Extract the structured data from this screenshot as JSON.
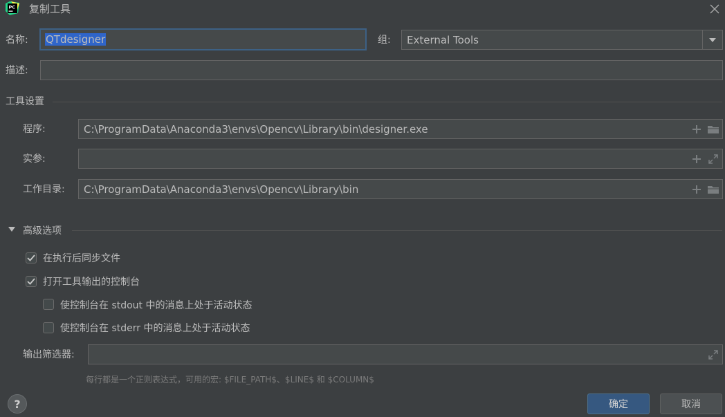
{
  "window": {
    "title": "复制工具"
  },
  "fields": {
    "name_label": "名称:",
    "name_value": "QTdesigner",
    "group_label": "组:",
    "group_value": "External Tools",
    "desc_label": "描述:",
    "desc_value": ""
  },
  "tool_settings": {
    "section_title": "工具设置",
    "program_label": "程序:",
    "program_value": "C:\\ProgramData\\Anaconda3\\envs\\Opencv\\Library\\bin\\designer.exe",
    "args_label": "实参:",
    "args_value": "",
    "workdir_label": "工作目录:",
    "workdir_value": "C:\\ProgramData\\Anaconda3\\envs\\Opencv\\Library\\bin"
  },
  "advanced": {
    "section_title": "高级选项",
    "sync_files_label": "在执行后同步文件",
    "sync_files_checked": true,
    "open_console_label": "打开工具输出的控制台",
    "open_console_checked": true,
    "stdout_label": "使控制台在 stdout 中的消息上处于活动状态",
    "stdout_checked": false,
    "stderr_label": "使控制台在 stderr 中的消息上处于活动状态",
    "stderr_checked": false,
    "output_filter_label": "输出筛选器:",
    "output_filter_value": "",
    "hint": "每行都是一个正则表达式，可用的宏: $FILE_PATH$、$LINE$ 和 $COLUMN$"
  },
  "buttons": {
    "ok": "确定",
    "cancel": "取消",
    "help": "?"
  },
  "colors": {
    "background": "#3c3f41",
    "field_bg": "#45494a",
    "accent": "#365880",
    "focus": "#3d6185",
    "selection": "#2f65ca"
  },
  "icons": {
    "app": "pycharm-logo",
    "close": "close-icon",
    "dropdown": "chevron-down-icon",
    "add": "plus-icon",
    "browse": "folder-icon",
    "expand": "expand-icon",
    "collapse": "triangle-down-icon",
    "check": "checkmark-icon",
    "help": "help-icon"
  }
}
